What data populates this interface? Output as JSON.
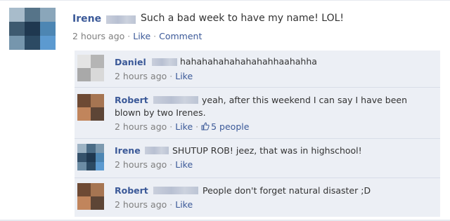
{
  "post": {
    "author": "Irene",
    "text": "Such a bad week to have my name! LOL!",
    "time": "2 hours ago",
    "like": "Like",
    "comment": "Comment",
    "separator": "·"
  },
  "comments": [
    {
      "author": "Daniel",
      "text": "hahahahahahahahahhaahahha",
      "time": "2 hours ago",
      "like": "Like"
    },
    {
      "author": "Robert",
      "text_line1": "yeah, after this weekend I can say I have been",
      "text_line2": "blown by two Irenes.",
      "time": "2 hours ago",
      "like": "Like",
      "likes_count": "5 people"
    },
    {
      "author": "Irene",
      "text": "SHUTUP ROB! jeez, that was in highschool!",
      "time": "2 hours ago",
      "like": "Like"
    },
    {
      "author": "Robert",
      "text": "People don't forget natural disaster ;D",
      "time": "2 hours ago",
      "like": "Like"
    }
  ],
  "colors": {
    "link_blue": "#3b5998",
    "comment_bg": "#eceff5",
    "meta_gray": "#7f7f7f"
  },
  "icons": {
    "thumb": "thumbs-up-icon"
  }
}
